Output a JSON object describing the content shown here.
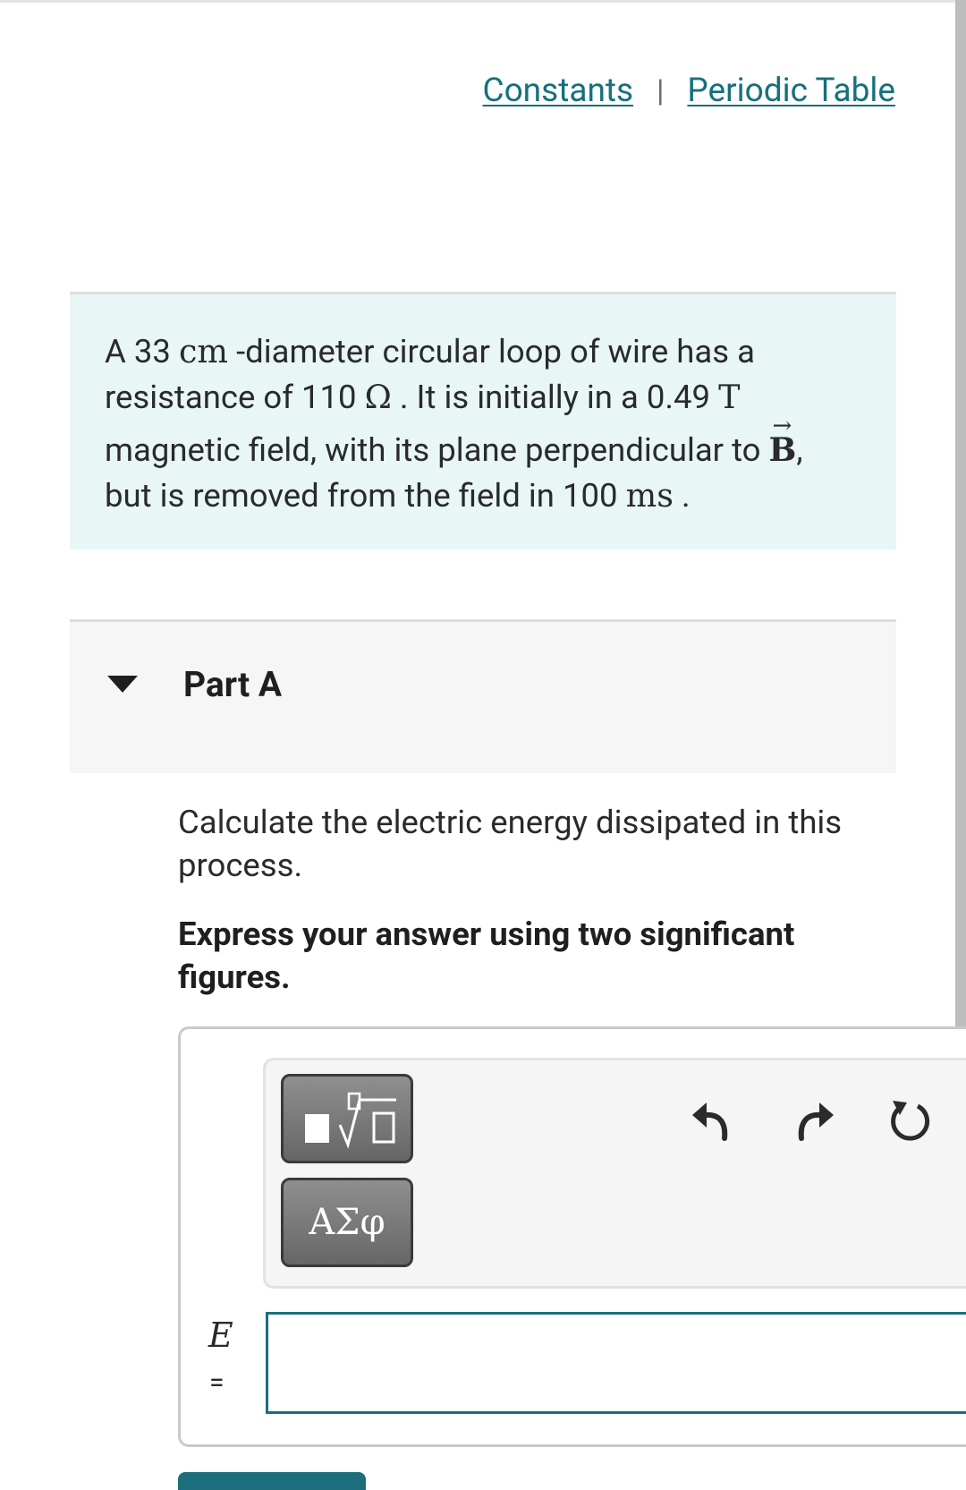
{
  "header": {
    "links": [
      "Constants",
      "Periodic Table"
    ],
    "separator": "|"
  },
  "problem": {
    "text_a": "A 33 ",
    "unit_cm": "cm",
    "text_b": " -diameter circular loop of wire has a",
    "text_c": "resistance of 110 ",
    "unit_ohm": "Ω",
    "text_d": " . It is initially in a 0.49 ",
    "unit_tesla": "T",
    "text_e": "magnetic field, with its plane perpendicular to ",
    "vector_symbol": "B",
    "vector_arrow": "→",
    "text_f": ",",
    "text_g": "but is removed from the field in 100 ",
    "unit_ms": "ms",
    "text_h": " ."
  },
  "part": {
    "title": "Part A",
    "question": "Calculate the electric energy dissipated in this process.",
    "instruction": "Express your answer using two significant figures."
  },
  "toolbar": {
    "greek_button": "ΑΣφ",
    "icons": [
      "templates-icon",
      "greek-letters-icon",
      "undo-icon",
      "redo-icon",
      "reset-icon"
    ]
  },
  "answer": {
    "variable": "E",
    "equals": "=",
    "value": ""
  },
  "colors": {
    "link": "#16707d",
    "problem_bg": "#e8f6f6",
    "input_border": "#1d6e7c"
  }
}
